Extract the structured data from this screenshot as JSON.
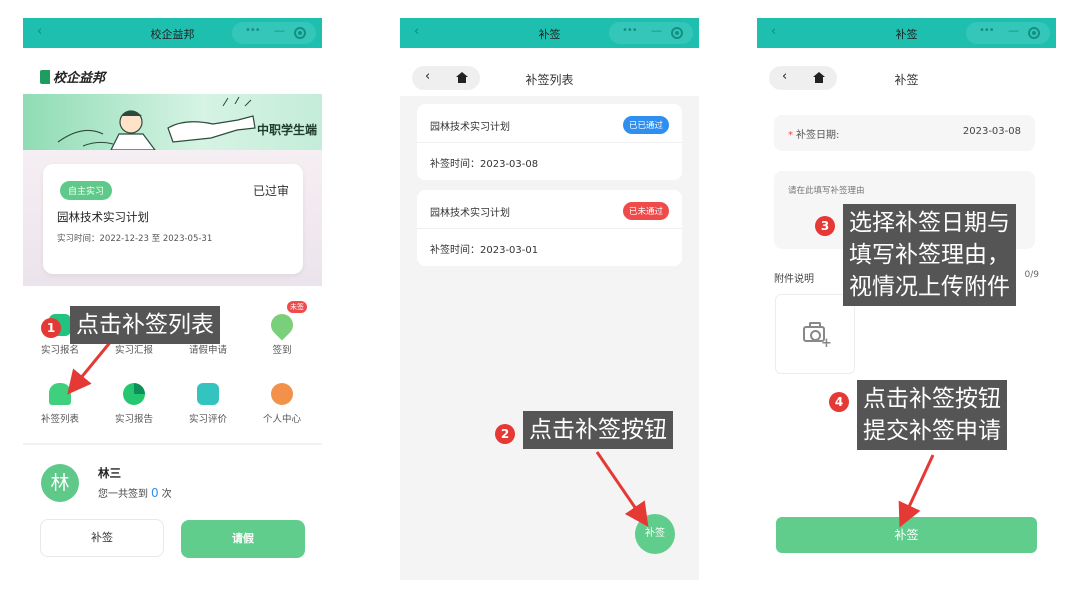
{
  "capsule": {
    "dots": "•••",
    "dash": "—"
  },
  "screen1": {
    "window_title": "校企益邦",
    "back": "‹",
    "brand": "校企益邦",
    "banner_text": "中职学生端",
    "plan_card": {
      "tag": "自主实习",
      "status": "已过审",
      "title": "园林技术实习计划",
      "date_prefix": "实习时间：",
      "date_start": "2022-12-23",
      "date_sep": "至",
      "date_end": "2023-05-31"
    },
    "grid": [
      {
        "label": "实习报名",
        "icon": "signup-icon",
        "color": "#21c37e"
      },
      {
        "label": "实习汇报",
        "icon": "report-icon",
        "color": "#2d6fd9"
      },
      {
        "label": "请假申请",
        "icon": "leave-icon",
        "color": "#1aa4a4"
      },
      {
        "label": "签到",
        "icon": "location-pin-icon",
        "color": "#7ad07a",
        "badge": "未签"
      },
      {
        "label": "补签列表",
        "icon": "bell-icon",
        "color": "#3fd07e"
      },
      {
        "label": "实习报告",
        "icon": "pie-chart-icon",
        "color": "#24c76f"
      },
      {
        "label": "实习评价",
        "icon": "evaluation-icon",
        "color": "#33c4c0"
      },
      {
        "label": "个人中心",
        "icon": "user-center-icon",
        "color": "#f2924a"
      }
    ],
    "user": {
      "avatar": "林",
      "name": "林三",
      "count_prefix": "您一共签到",
      "count": "0",
      "count_suffix": "次"
    },
    "buttons": {
      "supplement": "补签",
      "leave": "请假"
    }
  },
  "screen2": {
    "window_title": "补签",
    "page_title": "补签列表",
    "records": [
      {
        "title": "园林技术实习计划",
        "badge": "已已通过",
        "badge_color": "#2f8ff0",
        "date_label": "补签时间：",
        "date": "2023-03-08"
      },
      {
        "title": "园林技术实习计划",
        "badge": "已未通过",
        "badge_color": "#ef4b4b",
        "date_label": "补签时间：",
        "date": "2023-03-01"
      }
    ],
    "fab": "补签"
  },
  "screen3": {
    "window_title": "补签",
    "page_title": "补签",
    "date_field": {
      "required_mark": "*",
      "label": "补签日期:",
      "value": "2023-03-08"
    },
    "reason_placeholder": "请在此填写补签理由",
    "attachment_label": "附件说明",
    "attachment_count": "0/9",
    "submit": "补签"
  },
  "annotations": [
    {
      "num": "1",
      "lines": [
        "点击补签列表"
      ]
    },
    {
      "num": "2",
      "lines": [
        "点击补签按钮"
      ]
    },
    {
      "num": "3",
      "lines": [
        "选择补签日期与",
        "填写补签理由，",
        "视情况上传附件"
      ]
    },
    {
      "num": "4",
      "lines": [
        "点击补签按钮",
        "提交补签申请"
      ]
    }
  ],
  "colors": {
    "titlebar": "#1fbfaf",
    "primary_green": "#61cd8c",
    "callout_bg": "#555555",
    "marker_red": "#e53935"
  }
}
